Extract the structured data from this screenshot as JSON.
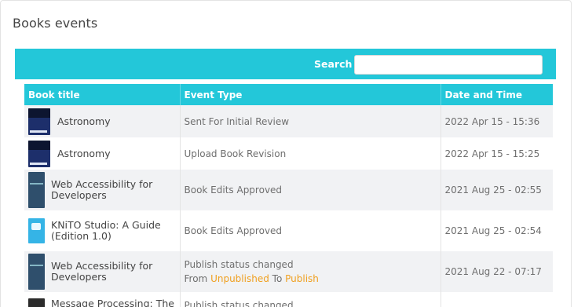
{
  "card": {
    "title": "Books events"
  },
  "search": {
    "label": "Search",
    "value": ""
  },
  "table": {
    "columns": [
      "Book title",
      "Event Type",
      "Date and Time"
    ],
    "rows": [
      {
        "book": "Astronomy",
        "event": "Sent For Initial Review",
        "date": "2022 Apr 15 - 15:36",
        "thumb": "astronomy-cover-icon"
      },
      {
        "book": "Astronomy",
        "event": "Upload Book Revision",
        "date": "2022 Apr 15 - 15:25",
        "thumb": "astronomy-cover-icon"
      },
      {
        "book": "Web Accessibility for Developers",
        "event": "Book Edits Approved",
        "date": "2021 Aug 25 - 02:55",
        "thumb": "web-accessibility-cover-icon"
      },
      {
        "book": "KNiTO Studio: A Guide (Edition 1.0)",
        "event": "Book Edits Approved",
        "date": "2021 Aug 25 - 02:54",
        "thumb": "knito-cover-icon"
      },
      {
        "book": "Web Accessibility for Developers",
        "event": "Publish status changed",
        "event_detail": {
          "from_label": "From",
          "from_value": "Unpublished",
          "to_label": "To",
          "to_value": "Publish"
        },
        "date": "2021 Aug 22 - 07:17",
        "thumb": "web-accessibility-cover-icon"
      },
      {
        "book": "Message Processing: The",
        "event": "Publish status changed",
        "date": "",
        "thumb": "message-processing-cover-icon"
      }
    ]
  },
  "colors": {
    "accent": "#23c7d9",
    "status_highlight": "#f0a020",
    "row_alt": "#f1f2f4"
  }
}
